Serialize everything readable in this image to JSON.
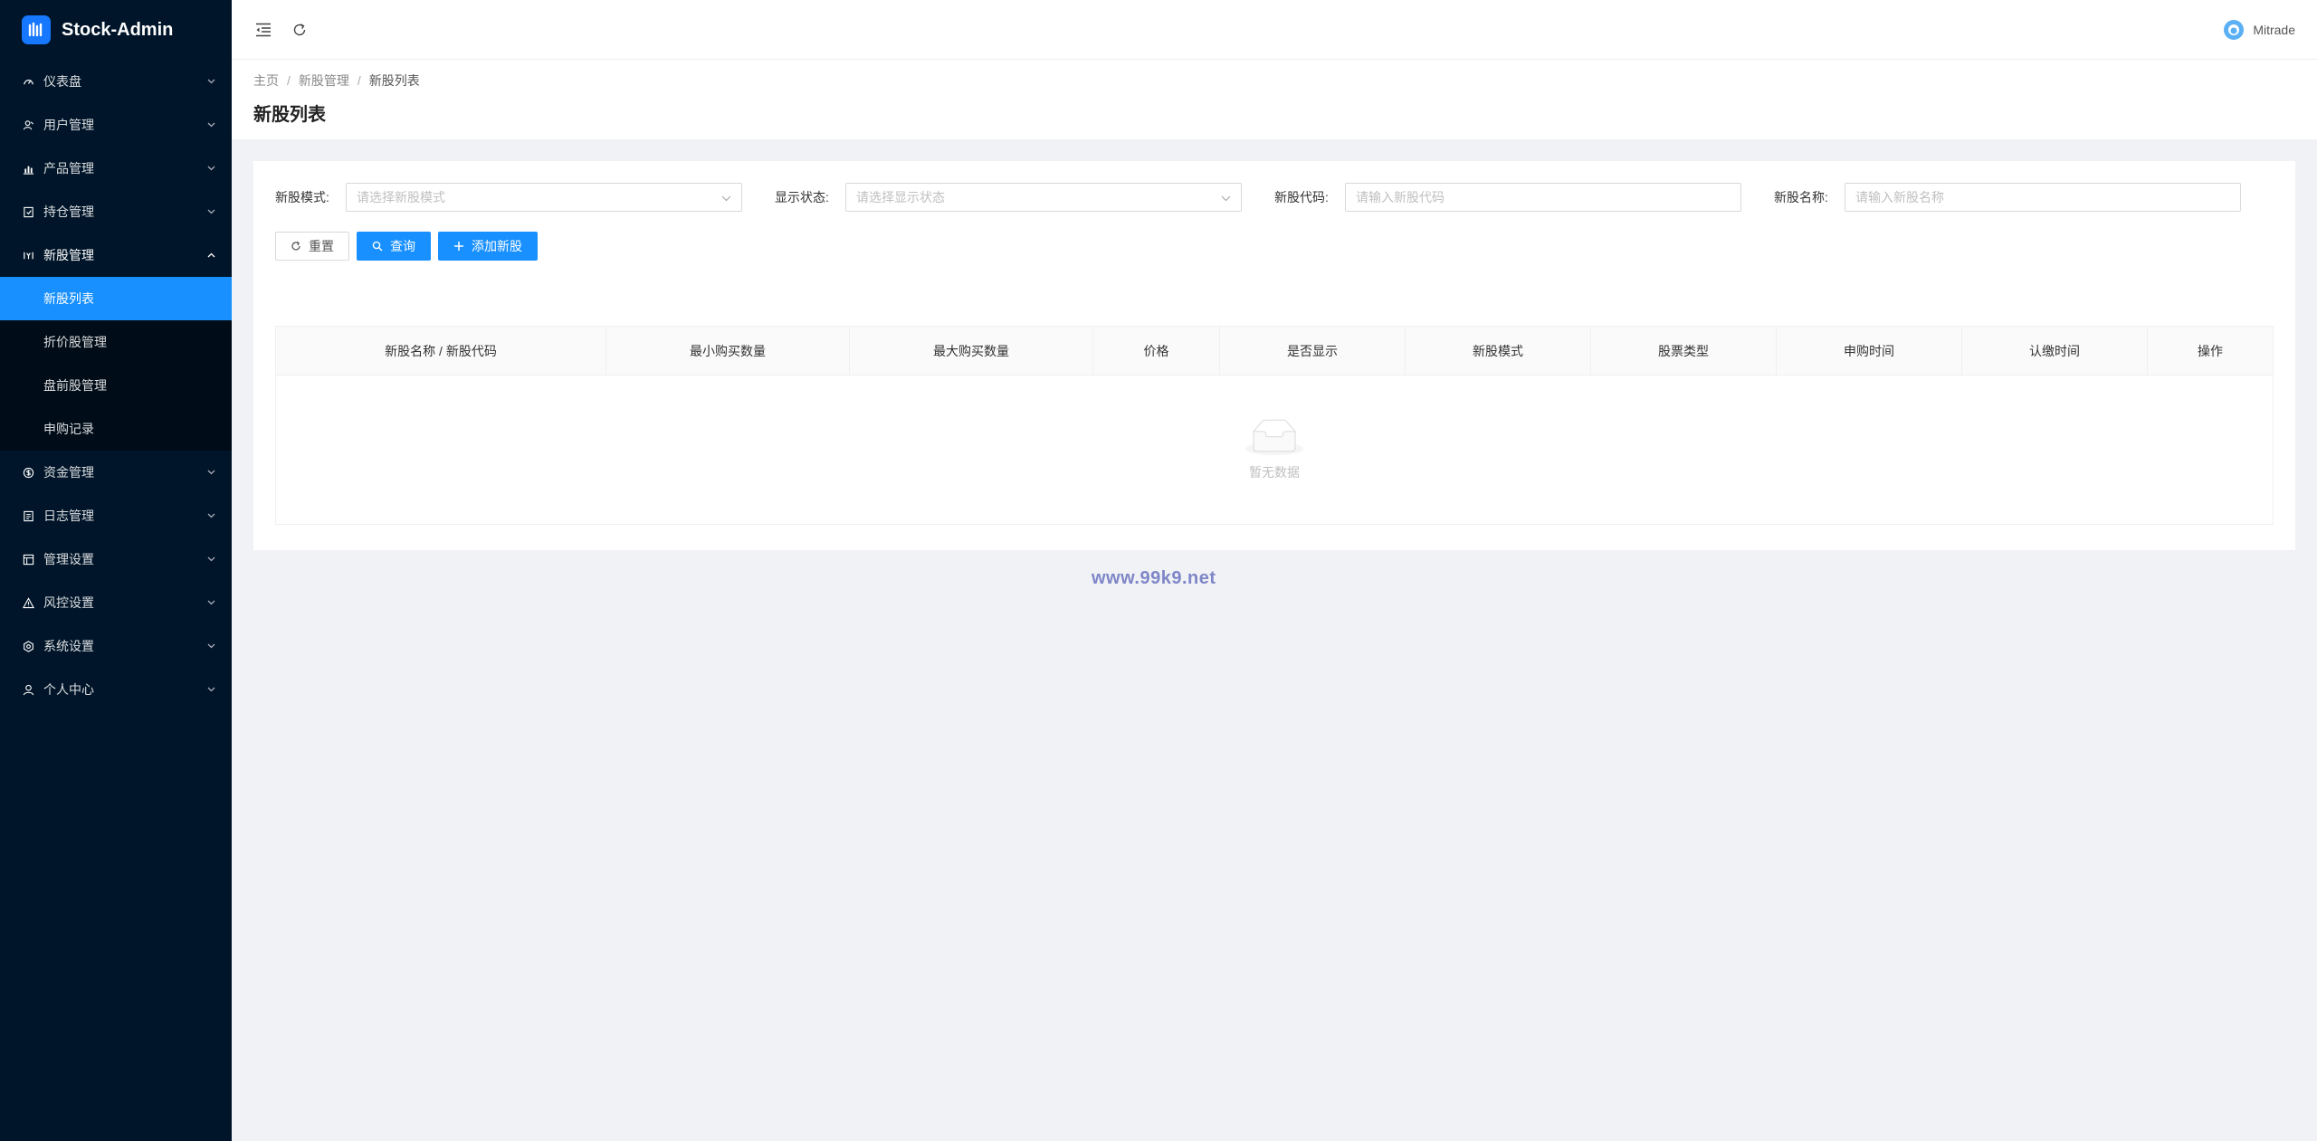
{
  "app": {
    "title": "Stock-Admin",
    "logo_icon": "stock-logo-icon"
  },
  "sidebar": {
    "items": [
      {
        "label": "仪表盘",
        "icon": "dashboard-icon"
      },
      {
        "label": "用户管理",
        "icon": "users-icon"
      },
      {
        "label": "产品管理",
        "icon": "chart-icon"
      },
      {
        "label": "持仓管理",
        "icon": "position-icon"
      },
      {
        "label": "新股管理",
        "icon": "ipo-icon",
        "open": true,
        "children": [
          {
            "label": "新股列表",
            "active": true
          },
          {
            "label": "折价股管理"
          },
          {
            "label": "盘前股管理"
          },
          {
            "label": "申购记录"
          }
        ]
      },
      {
        "label": "资金管理",
        "icon": "money-icon"
      },
      {
        "label": "日志管理",
        "icon": "log-icon"
      },
      {
        "label": "管理设置",
        "icon": "admin-icon"
      },
      {
        "label": "风控设置",
        "icon": "warning-icon"
      },
      {
        "label": "系统设置",
        "icon": "settings-icon"
      },
      {
        "label": "个人中心",
        "icon": "user-icon"
      }
    ]
  },
  "header": {
    "user_name": "Mitrade"
  },
  "breadcrumb": {
    "home": "主页",
    "parent": "新股管理",
    "current": "新股列表"
  },
  "page_title": "新股列表",
  "filters": [
    {
      "label": "新股模式:",
      "placeholder": "请选择新股模式",
      "type": "select"
    },
    {
      "label": "显示状态:",
      "placeholder": "请选择显示状态",
      "type": "select"
    },
    {
      "label": "新股代码:",
      "placeholder": "请输入新股代码",
      "type": "input"
    },
    {
      "label": "新股名称:",
      "placeholder": "请输入新股名称",
      "type": "input"
    }
  ],
  "buttons": {
    "reset": "重置",
    "search": "查询",
    "add": "添加新股"
  },
  "table": {
    "columns": [
      "新股名称 / 新股代码",
      "最小购买数量",
      "最大购买数量",
      "价格",
      "是否显示",
      "新股模式",
      "股票类型",
      "申购时间",
      "认缴时间",
      "操作"
    ],
    "empty_text": "暂无数据"
  },
  "watermark": "www.99k9.net",
  "colors": {
    "sidebar_bg": "#001529",
    "accent": "#1890ff",
    "submenu_bg": "#000c17"
  }
}
